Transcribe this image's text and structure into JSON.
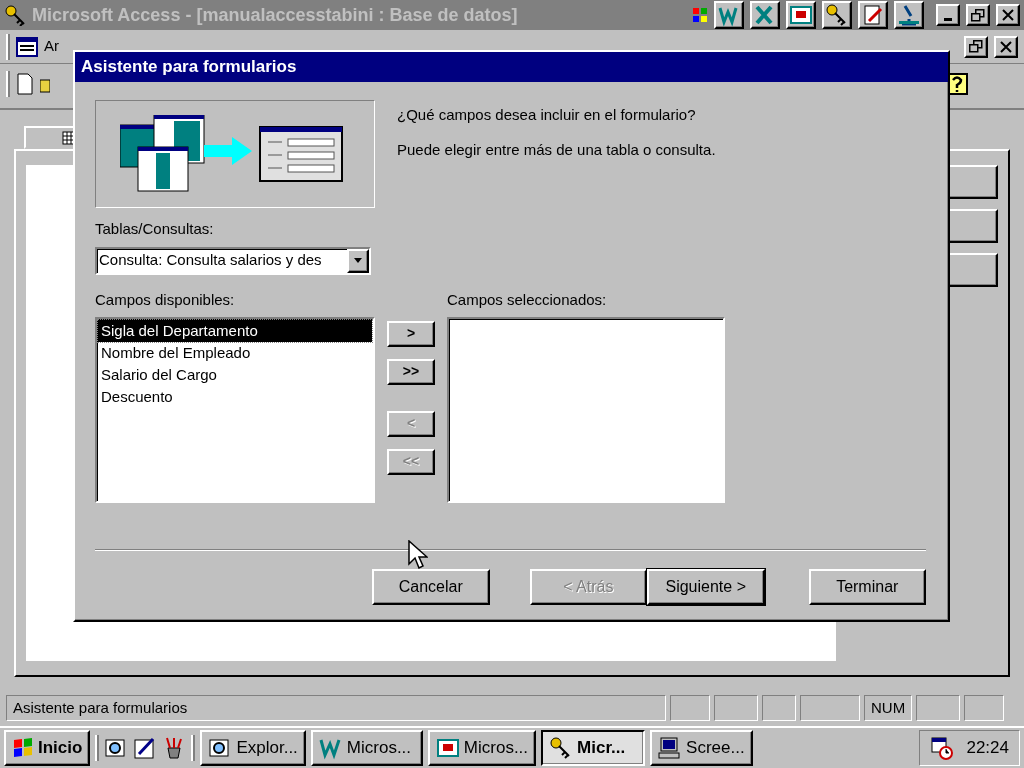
{
  "app": {
    "title": "Microsoft Access - [manualaccesstabini : Base de datos]"
  },
  "menu_bar": {
    "items": [
      "Ar"
    ]
  },
  "dialog": {
    "title": "Asistente para formularios",
    "question": "¿Qué campos desea incluir en el formulario?",
    "hint": "Puede elegir entre más de una tabla o consulta.",
    "source_label": "Tablas/Consultas:",
    "source_value": "Consulta: Consulta salarios y des",
    "available_label": "Campos disponibles:",
    "available_fields": [
      {
        "label": "Sigla del Departamento",
        "selected": true
      },
      {
        "label": "Nombre del Empleado",
        "selected": false
      },
      {
        "label": "Salario del Cargo",
        "selected": false
      },
      {
        "label": "Descuento",
        "selected": false
      }
    ],
    "selected_label": "Campos seleccionados:",
    "move_buttons": [
      {
        "label": ">",
        "disabled": false
      },
      {
        "label": ">>",
        "disabled": false
      },
      {
        "label": "<",
        "disabled": true
      },
      {
        "label": "<<",
        "disabled": true
      }
    ],
    "footer_buttons": [
      {
        "label": "Cancelar",
        "disabled": false,
        "default": false
      },
      {
        "label": "< Atrás",
        "disabled": true,
        "default": false
      },
      {
        "label": "Siguiente >",
        "disabled": false,
        "default": true
      },
      {
        "label": "Terminar",
        "disabled": false,
        "default": false
      }
    ]
  },
  "status_bar": {
    "text": "Asistente para formularios",
    "indicators": [
      {
        "text": "NUM"
      }
    ]
  },
  "taskbar": {
    "start": "Inicio",
    "tasks": [
      {
        "label": "Explor...",
        "kind": "explorer",
        "selected": false
      },
      {
        "label": "Micros...",
        "kind": "word",
        "selected": false
      },
      {
        "label": "Micros...",
        "kind": "powerpoint",
        "selected": false
      },
      {
        "label": "Micr...",
        "kind": "access",
        "selected": true
      },
      {
        "label": "Scree...",
        "kind": "computer",
        "selected": false
      }
    ],
    "clock": "22:24"
  }
}
